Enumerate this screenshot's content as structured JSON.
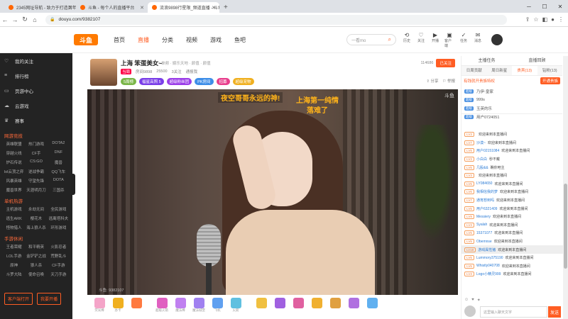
{
  "browser": {
    "tabs": [
      {
        "title": "2345网址导航 - 致力于打造百年品牌",
        "active": false
      },
      {
        "title": "斗鱼 - 每个人的直播平台",
        "active": false
      },
      {
        "title": "流浪9898行星限_频道直播 - 斗鱼",
        "active": true
      }
    ],
    "url": "douyu.com/9382107"
  },
  "header": {
    "logo": "斗鱼",
    "nav": [
      "首页",
      "直播",
      "分类",
      "视频",
      "游戏",
      "鱼吧"
    ],
    "active_nav": "直播",
    "search_placeholder": "一看mo",
    "icons": [
      {
        "icon": "history-icon",
        "label": "历史"
      },
      {
        "icon": "follow-icon",
        "label": "关注"
      },
      {
        "icon": "live-icon",
        "label": "开播"
      },
      {
        "icon": "client-icon",
        "label": "客户端"
      },
      {
        "icon": "task-icon",
        "label": "任务"
      },
      {
        "icon": "message-icon",
        "label": "消息"
      }
    ]
  },
  "sidebar": {
    "items": [
      {
        "icon": "heart-icon",
        "label": "我的关注"
      },
      {
        "icon": "rank-icon",
        "label": "排行榜"
      },
      {
        "icon": "video-icon",
        "label": "页游中心"
      },
      {
        "icon": "cloud-icon",
        "label": "云游戏"
      },
      {
        "icon": "game-icon",
        "label": "赛事"
      }
    ],
    "sections": [
      {
        "title": "网游竞技",
        "items": [
          "英雄联盟",
          "热门游戏",
          "DOTA2",
          "穿越火线",
          "CF手",
          "DNF",
          "炉石传说",
          "CS:GO",
          "魔兽",
          "lol云顶之弈",
          "逆战争霸",
          "QQ飞车",
          "风暴英雄",
          "守望先锋",
          "DOTA",
          "魔兽世界",
          "天涯明月刀",
          "三国杀"
        ]
      },
      {
        "title": "单机热游",
        "items": [
          "主机游戏",
          "永劫无间",
          "全民游戏",
          "逃生ARK",
          "樱花木",
          "逃离塔科夫",
          "怪物猎人",
          "海上狼人杀",
          "环形游戏"
        ]
      },
      {
        "title": "手游休闲",
        "items": [
          "王者荣耀",
          "和平精英",
          "火影忍者",
          "LOL手游",
          "金铲铲之战",
          "荒野乱斗",
          "原神",
          "狼人杀",
          "CF手游",
          "斗罗大陆",
          "使命召唤",
          "天刀手游"
        ]
      }
    ],
    "bottom_buttons": [
      "客户端打开",
      "我要开播"
    ]
  },
  "room": {
    "title": "上海 笨蛋美女~",
    "category": "单频 · 娱乐天地 · 颜值 · 颜值",
    "room_tag": "当周",
    "room_id": "房间9898",
    "fans": "25500",
    "followers_label": "3关注",
    "report": "通报我",
    "badges": [
      {
        "text": "5周榜",
        "color": "#7ab648"
      },
      {
        "text": "福星高照 5",
        "color": "#7a3ee8"
      },
      {
        "text": "超级粉丝团",
        "color": "#9b3ee8"
      },
      {
        "text": "PK房间",
        "color": "#3e8ee8"
      },
      {
        "text": "招募",
        "color": "#e83e8c"
      },
      {
        "text": "超级宠物",
        "color": "#f0b020"
      }
    ],
    "followers": "114686",
    "follow_label": "已关注",
    "share_label": "分享",
    "report_label": "举报"
  },
  "player": {
    "overlay_text_1": "夜空哥哥永远的神!",
    "overlay_text_2_line1": "上海第一纯情",
    "overlay_text_2_line2": "落难了",
    "watermark": "斗鱼",
    "room_watermark": "斗鱼: 9382107"
  },
  "gifts": [
    {
      "name": "荧光棒",
      "color": "#f4a4c8"
    },
    {
      "name": "办卡",
      "color": "#f0b020"
    },
    {
      "name": "",
      "color": "#ff7a40"
    },
    {
      "name": "超级火箭",
      "color": "#e060c0"
    },
    {
      "name": "魔法棒",
      "color": "#c080f0"
    },
    {
      "name": "魔法城堡",
      "color": "#a080f0"
    },
    {
      "name": "飞机",
      "color": "#60a0f0"
    },
    {
      "name": "火箭",
      "color": "#60c0e0"
    },
    {
      "name": "",
      "color": "#f0c040"
    },
    {
      "name": "",
      "color": "#a060e0"
    },
    {
      "name": "",
      "color": "#e060a0"
    },
    {
      "name": "",
      "color": "#f0b030"
    },
    {
      "name": "",
      "color": "#e0a040"
    },
    {
      "name": "",
      "color": "#b070e0"
    },
    {
      "name": "",
      "color": "#60b0f0"
    }
  ],
  "right_panel": {
    "top_tabs": [
      "主播任务",
      "直播回顾"
    ],
    "tabs": [
      "日周贡献",
      "周日新星",
      "贵宾(13)",
      "钻粉(13)"
    ],
    "active_tab": "贵宾(13)",
    "notice": "有钱就开贵族特权",
    "open_label": "开通贵族",
    "rank": [
      {
        "lv": "超级",
        "name": "乃伊·皇家"
      },
      {
        "lv": "超级",
        "name": "999s"
      },
      {
        "lv": "超级",
        "name": "玉英的乐"
      },
      {
        "lv": "超级",
        "name": "用户0724051"
      }
    ],
    "messages": [
      {
        "lv": "LV3",
        "nick": "",
        "txt": "欢迎来到本直播间"
      },
      {
        "lv": "LV7",
        "nick": "沙漠~",
        "txt": "欢迎来到本直播间"
      },
      {
        "lv": "LV5",
        "nick": "用户02151084",
        "txt": "欢迎来到本直播间"
      },
      {
        "lv": "LV3",
        "nick": "小白白",
        "txt": "秒不戴"
      },
      {
        "lv": "LV5",
        "nick": "几股&&",
        "txt": "瞧你吧主"
      },
      {
        "lv": "LV3",
        "nick": "",
        "txt": "欢迎来到本直播间"
      },
      {
        "lv": "LV5",
        "nick": "LY084650",
        "txt": "欢迎来到本直播间"
      },
      {
        "lv": "LV6",
        "nick": "我相信我的梦",
        "txt": "欢迎来到本直播间"
      },
      {
        "lv": "LV7",
        "nick": "通宵想到吗",
        "txt": "欢迎来到本直播间"
      },
      {
        "lv": "LV5",
        "nick": "用户6321409",
        "txt": "欢迎来到本直播间"
      },
      {
        "lv": "LV9",
        "nick": "Messiery",
        "txt": "欢迎来到本直播间"
      },
      {
        "lv": "LV3",
        "nick": "Syalah",
        "txt": "欢迎来到本直播间"
      },
      {
        "lv": "LV5",
        "nick": "15371077",
        "txt": "欢迎来到本直播间"
      },
      {
        "lv": "LV5",
        "nick": "Obemnse",
        "txt": "欢迎来到本直播间"
      },
      {
        "lv": "LV18",
        "nick": "游戏属性猪",
        "txt": "欢迎来到本直播间",
        "hl": true
      },
      {
        "lv": "LV5",
        "nick": "Lummory375190",
        "txt": "欢迎来到本直播间"
      },
      {
        "lv": "LV5",
        "nick": "Whistly040708",
        "txt": "欢迎来到本直播间"
      },
      {
        "lv": "LV3",
        "nick": "Logo小精灵999",
        "txt": "欢迎来到本直播间"
      }
    ],
    "input_placeholder": "这里输入聊天文字",
    "send_label": "发送"
  }
}
